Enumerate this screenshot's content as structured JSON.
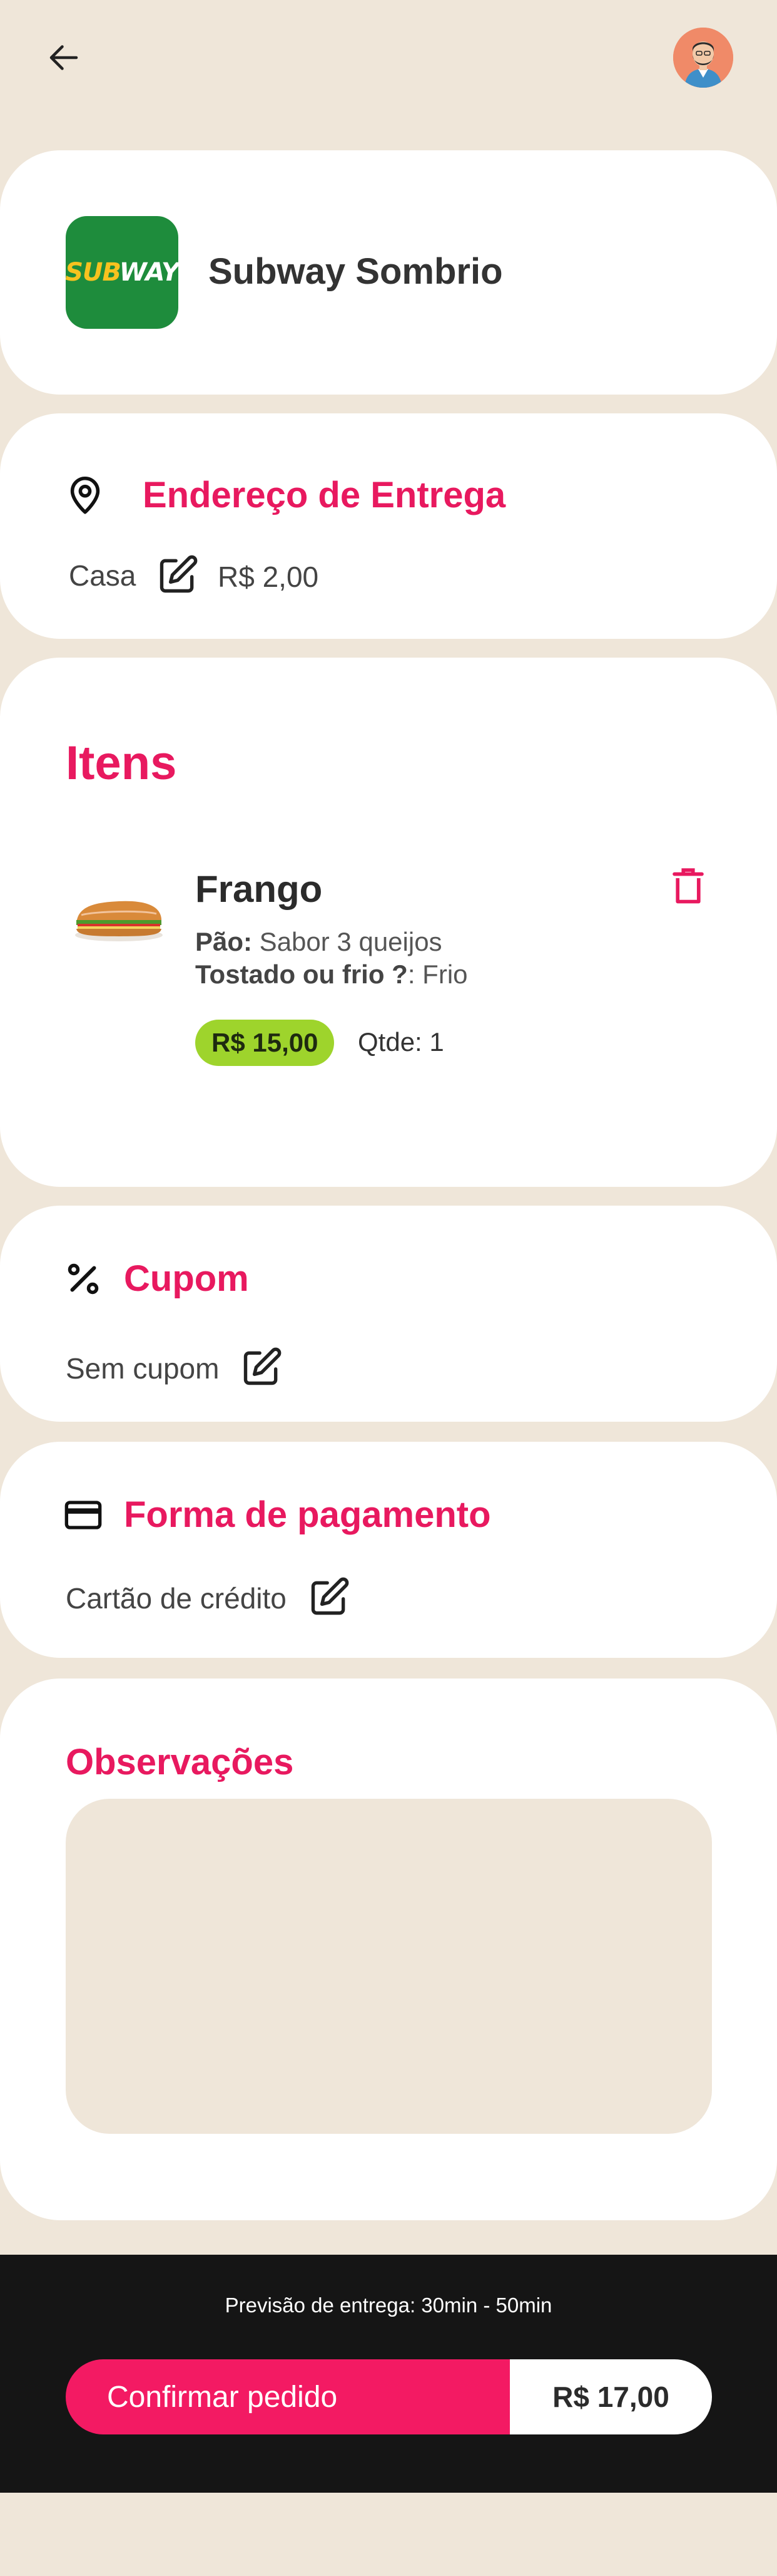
{
  "header": {
    "back_icon": "arrow-left-icon",
    "avatar_icon": "user-avatar-icon"
  },
  "store": {
    "logo_text_a": "SUB",
    "logo_text_b": "WAY",
    "logo_color": "#1E8C3C",
    "name": "Subway Sombrio"
  },
  "address": {
    "title": "Endereço de Entrega",
    "icon": "location-pin-icon",
    "label": "Casa",
    "fee": "R$ 2,00"
  },
  "items": {
    "title": "Itens",
    "list": [
      {
        "name": "Frango",
        "detail1_label": "Pão:",
        "detail1_value": " Sabor 3 queijos",
        "detail2_label": "Tostado ou frio ?",
        "detail2_value": ": Frio",
        "price": "R$ 15,00",
        "qty": "Qtde: 1"
      }
    ]
  },
  "coupon": {
    "title": "Cupom",
    "icon": "percent-icon",
    "value": "Sem cupom"
  },
  "payment": {
    "title": "Forma de pagamento",
    "icon": "credit-card-icon",
    "value": "Cartão de crédito"
  },
  "notes": {
    "title": "Observações",
    "placeholder": ""
  },
  "footer": {
    "eta": "Previsão de entrega: 30min - 50min",
    "confirm_label": "Confirmar pedido",
    "total": "R$ 17,00"
  },
  "colors": {
    "accent": "#E8195F",
    "confirm": "#F31A63",
    "price_pill": "#9ED42C",
    "background": "#EFE6D9",
    "footer": "#151515"
  }
}
